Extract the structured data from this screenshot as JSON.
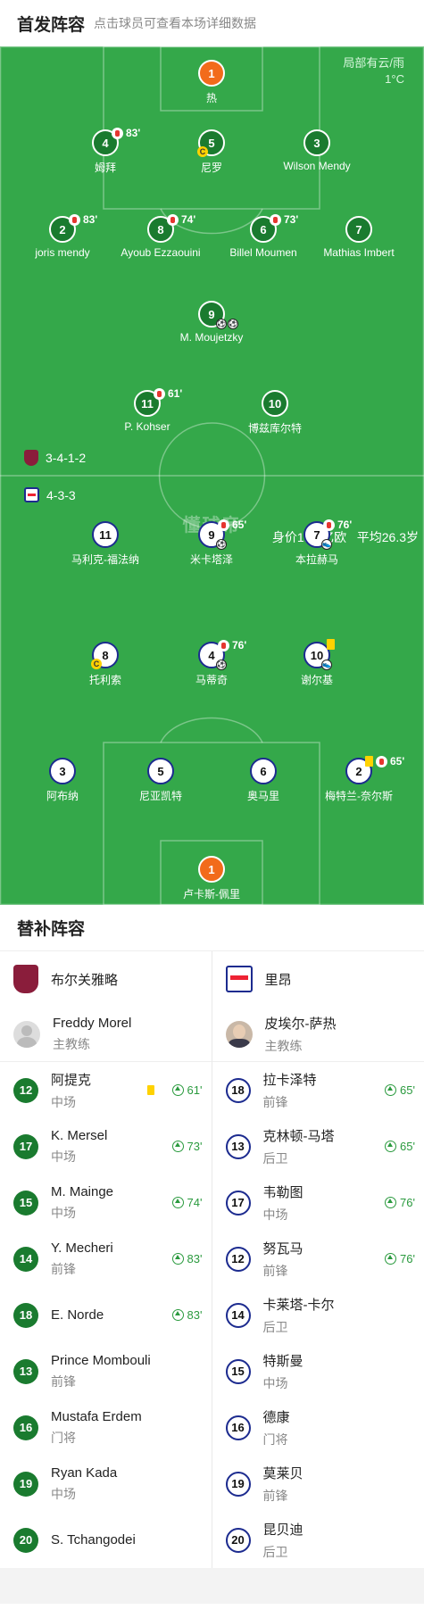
{
  "header": {
    "title": "首发阵容",
    "subtitle": "点击球员可查看本场详细数据"
  },
  "weather": {
    "condition": "局部有云/雨",
    "temp": "1°C"
  },
  "watermark": "懂球帝",
  "home_formation": "3-4-1-2",
  "away_formation": "4-3-3",
  "away_value": "身价1.46亿欧",
  "away_avg_age": "平均26.3岁",
  "home_players": [
    {
      "num": "1",
      "name": "热",
      "gk": true
    },
    {
      "num": "4",
      "name": "姆拜",
      "sub": "83'"
    },
    {
      "num": "5",
      "name": "尼罗",
      "captain": true
    },
    {
      "num": "3",
      "name": "Wilson Mendy"
    },
    {
      "num": "2",
      "name": "joris mendy",
      "sub": "83'"
    },
    {
      "num": "8",
      "name": "Ayoub Ezzaouini",
      "sub": "74'"
    },
    {
      "num": "6",
      "name": "Billel Moumen",
      "sub": "73'"
    },
    {
      "num": "7",
      "name": "Mathias Imbert"
    },
    {
      "num": "9",
      "name": "M. Moujetzky",
      "goals": 2
    },
    {
      "num": "11",
      "name": "P. Kohser",
      "sub": "61'"
    },
    {
      "num": "10",
      "name": "博兹库尔特"
    }
  ],
  "away_players": [
    {
      "num": "11",
      "name": "马利克-福法纳"
    },
    {
      "num": "9",
      "name": "米卡塔泽",
      "sub": "65'",
      "goals": 1
    },
    {
      "num": "7",
      "name": "本拉赫马",
      "sub": "76'",
      "assist": true
    },
    {
      "num": "8",
      "name": "托利索",
      "captain": true
    },
    {
      "num": "4",
      "name": "马蒂奇",
      "sub": "76'",
      "goals": 1
    },
    {
      "num": "10",
      "name": "谢尔基",
      "yellow": true,
      "assist": true
    },
    {
      "num": "3",
      "name": "阿布纳"
    },
    {
      "num": "5",
      "name": "尼亚凯特"
    },
    {
      "num": "6",
      "name": "奥马里"
    },
    {
      "num": "2",
      "name": "梅特兰-奈尔斯",
      "yellow": true,
      "sub": "65'"
    },
    {
      "num": "1",
      "name": "卢卡斯-佩里",
      "gk": true
    }
  ],
  "captain_mark": "C",
  "subs_title": "替补阵容",
  "home_team": "布尔关雅略",
  "away_team": "里昂",
  "home_coach": {
    "name": "Freddy Morel",
    "role": "主教练"
  },
  "away_coach": {
    "name": "皮埃尔-萨热",
    "role": "主教练"
  },
  "home_subs": [
    {
      "num": "12",
      "name": "阿提克",
      "pos": "中场",
      "in": "61'",
      "yellow": true
    },
    {
      "num": "17",
      "name": "K. Mersel",
      "pos": "中场",
      "in": "73'"
    },
    {
      "num": "15",
      "name": "M. Mainge",
      "pos": "中场",
      "in": "74'"
    },
    {
      "num": "14",
      "name": "Y. Mecheri",
      "pos": "前锋",
      "in": "83'"
    },
    {
      "num": "18",
      "name": "E. Norde",
      "pos": "",
      "in": "83'"
    },
    {
      "num": "13",
      "name": "Prince Mombouli",
      "pos": "前锋",
      "in": ""
    },
    {
      "num": "16",
      "name": "Mustafa Erdem",
      "pos": "门将",
      "in": ""
    },
    {
      "num": "19",
      "name": "Ryan Kada",
      "pos": "中场",
      "in": ""
    },
    {
      "num": "20",
      "name": "S. Tchangodei",
      "pos": "",
      "in": ""
    }
  ],
  "away_subs": [
    {
      "num": "18",
      "name": "拉卡泽特",
      "pos": "前锋",
      "in": "65'"
    },
    {
      "num": "13",
      "name": "克林顿-马塔",
      "pos": "后卫",
      "in": "65'"
    },
    {
      "num": "17",
      "name": "韦勒图",
      "pos": "中场",
      "in": "76'"
    },
    {
      "num": "12",
      "name": "努瓦马",
      "pos": "前锋",
      "in": "76'"
    },
    {
      "num": "14",
      "name": "卡莱塔-卡尔",
      "pos": "后卫",
      "in": ""
    },
    {
      "num": "15",
      "name": "特斯曼",
      "pos": "中场",
      "in": ""
    },
    {
      "num": "16",
      "name": "德康",
      "pos": "门将",
      "in": ""
    },
    {
      "num": "19",
      "name": "莫莱贝",
      "pos": "前锋",
      "in": ""
    },
    {
      "num": "20",
      "name": "昆贝迪",
      "pos": "后卫",
      "in": ""
    }
  ],
  "colors": {
    "pitch": "#34a84a",
    "home": "#1a7b2f",
    "gk": "#f26b1b",
    "away_border": "#1c2b8f"
  }
}
